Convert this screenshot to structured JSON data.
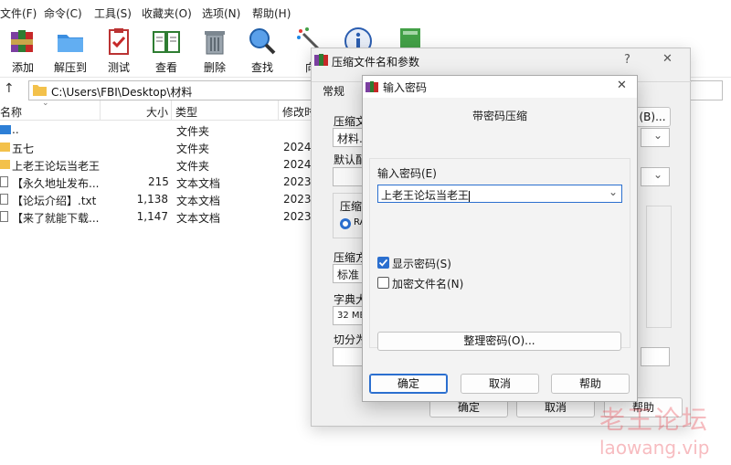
{
  "menu": [
    "文件(F)",
    "命令(C)",
    "工具(S)",
    "收藏夹(O)",
    "选项(N)",
    "帮助(H)"
  ],
  "toolbar": {
    "add": "添加",
    "extract": "解压到",
    "test": "测试",
    "view": "查看",
    "delete": "删除",
    "find": "查找",
    "wizard": "向"
  },
  "address": {
    "path": "C:\\Users\\FBI\\Desktop\\材料"
  },
  "columns": {
    "name": "名称",
    "size": "大小",
    "type": "类型",
    "modified": "修改时"
  },
  "files": [
    {
      "name": "..",
      "size": "",
      "type": "文件夹",
      "modified": ""
    },
    {
      "name": "五七",
      "size": "",
      "type": "文件夹",
      "modified": "2024,"
    },
    {
      "name": "上老王论坛当老王",
      "size": "",
      "type": "文件夹",
      "modified": "2024,"
    },
    {
      "name": "【永久地址发布...",
      "size": "215",
      "type": "文本文档",
      "modified": "2023,"
    },
    {
      "name": "【论坛介绍】.txt",
      "size": "1,138",
      "type": "文本文档",
      "modified": "2023,"
    },
    {
      "name": "【来了就能下载...",
      "size": "1,147",
      "type": "文本文档",
      "modified": "2023,"
    }
  ],
  "archive_dialog": {
    "title": "压缩文件名和参数",
    "help_glyph": "?",
    "close_glyph": "✕",
    "tab_general": "常规",
    "archive_name_label": "压缩文",
    "archive_name_value": "材料.r",
    "browse_button": "(B)...",
    "default_config_label": "默认配",
    "format_group_label": "压缩",
    "format_rar": "RA",
    "method_label": "压缩方",
    "method_value": "标准",
    "dict_label": "字典大",
    "dict_value": "32 MB",
    "split_label": "切分为",
    "ok": "确定",
    "cancel": "取消",
    "help": "帮助"
  },
  "password_dialog": {
    "title": "输入密码",
    "close_glyph": "✕",
    "heading": "带密码压缩",
    "password_label": "输入密码(E)",
    "password_value": "上老王论坛当老王",
    "show_password": {
      "label": "显示密码(S)",
      "checked": true
    },
    "encrypt_names": {
      "label": "加密文件名(N)",
      "checked": false
    },
    "organize_button": "整理密码(O)...",
    "ok": "确定",
    "cancel": "取消",
    "help": "帮助"
  },
  "watermark": {
    "line1": "老王论坛",
    "line2": "laowang.vip"
  }
}
